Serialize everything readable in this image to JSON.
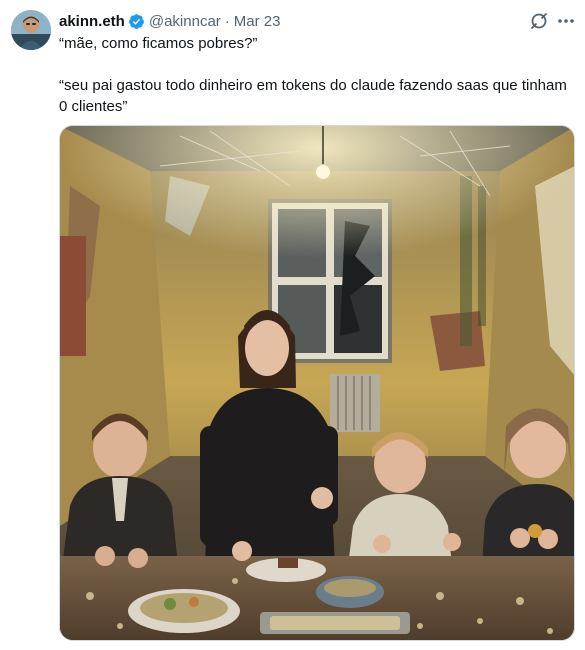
{
  "author": {
    "display_name": "akinn.eth",
    "handle": "@akinncar",
    "separator": "·",
    "date": "Mar 23",
    "verified": true
  },
  "tweet": {
    "line1": "“mãe, como ficamos pobres?”",
    "line2": "“seu pai gastou todo dinheiro em tokens do claude fazendo saas que tinham 0 clientes”"
  },
  "colors": {
    "verified_blue": "#1d9bf0",
    "secondary_text": "#536471",
    "primary_text": "#0f1419"
  },
  "icons": {
    "grok": "grok-icon",
    "more": "more-icon",
    "verified": "verified-badge-icon"
  },
  "media": {
    "kind": "photo",
    "subject": "woman smiling with three children at a table in a decaying room"
  }
}
